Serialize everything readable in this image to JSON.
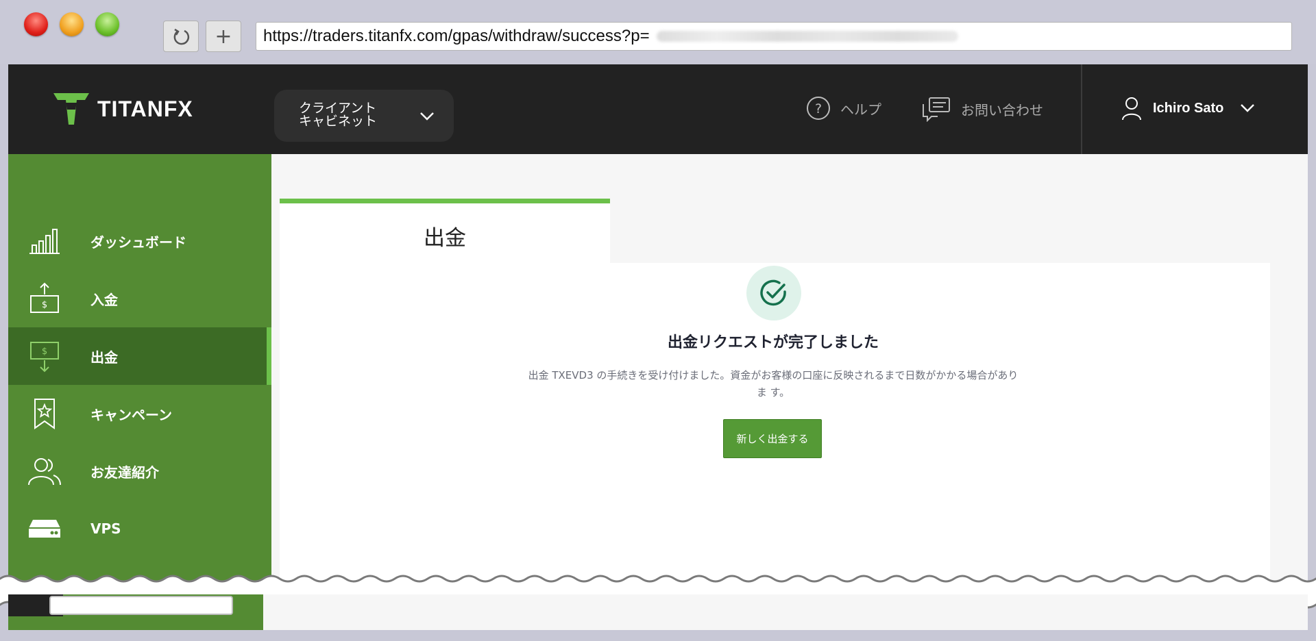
{
  "browser": {
    "url": "https://traders.titanfx.com/gpas/withdraw/success?p=",
    "new_tab_label": "+"
  },
  "header": {
    "logo_text": "TITANFX",
    "cabinet_line1": "クライアント",
    "cabinet_line2": "キャビネット",
    "help_label": "ヘルプ",
    "contact_label": "お問い合わせ",
    "user_name": "Ichiro Sato"
  },
  "sidebar": {
    "items": [
      {
        "label": "ダッシュボード",
        "icon": "chart-bars-icon",
        "active": false
      },
      {
        "label": "入金",
        "icon": "deposit-icon",
        "active": false
      },
      {
        "label": "出金",
        "icon": "withdraw-icon",
        "active": true
      },
      {
        "label": "キャンペーン",
        "icon": "bookmark-star-icon",
        "active": false
      },
      {
        "label": "お友達紹介",
        "icon": "users-icon",
        "active": false
      },
      {
        "label": "VPS",
        "icon": "server-icon",
        "active": false
      }
    ]
  },
  "main": {
    "tab_label": "出金",
    "success_title": "出金リクエストが完了しました",
    "success_message": "出金 TXEVD3 の手続きを受け付けました。資金がお客様の口座に反映されるまで日数がかかる場合がありま す。",
    "new_withdraw_button": "新しく出金する"
  },
  "colors": {
    "brand_green": "#6cc04a",
    "sidebar_green": "#548b33",
    "sidebar_active": "#3c6b25",
    "topbar": "#222222",
    "button_green": "#559a36"
  }
}
